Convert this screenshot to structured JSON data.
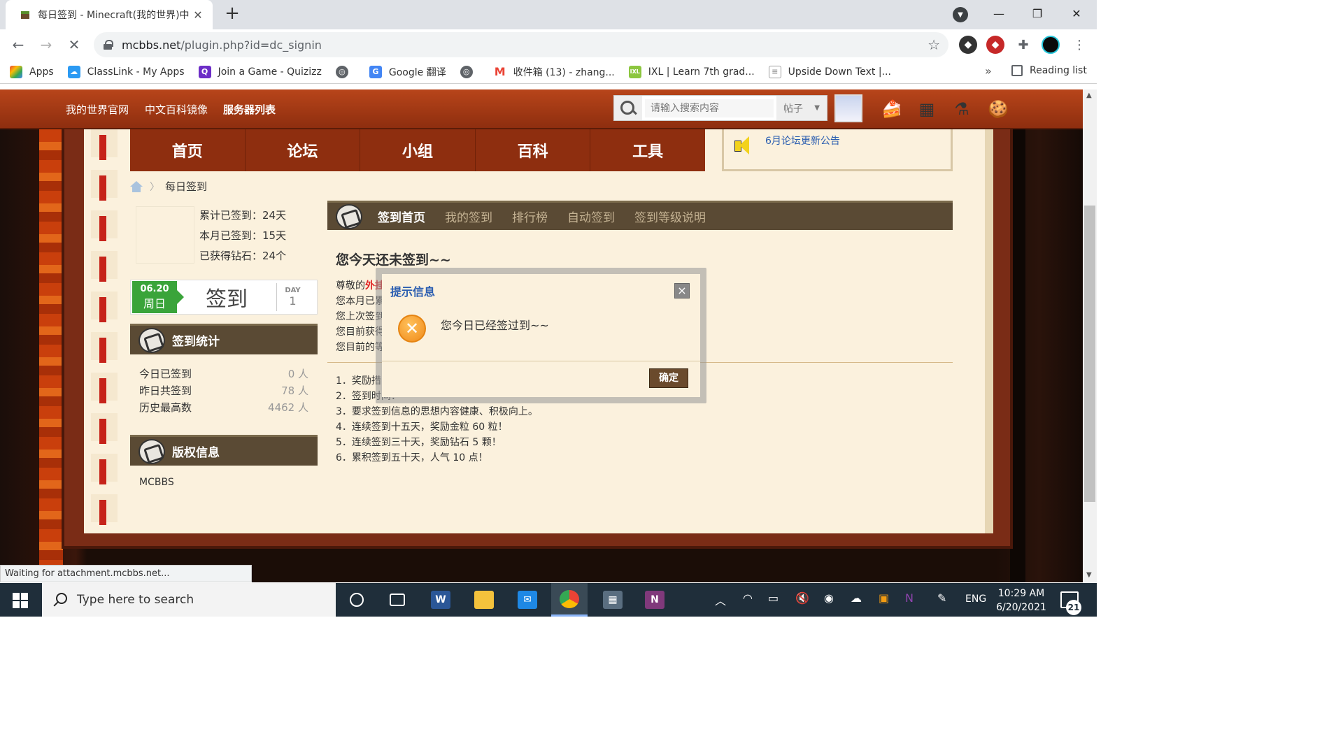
{
  "browser": {
    "tab_title": "每日签到 - Minecraft(我的世界)中",
    "url_host": "mcbbs.net",
    "url_path": "/plugin.php?id=dc_signin",
    "bookmarks": [
      {
        "label": "Apps",
        "icon": "apps-grid-icon",
        "color": "#e8453c"
      },
      {
        "label": "ClassLink - My Apps",
        "icon": "classlink-icon",
        "color": "#2b9af3"
      },
      {
        "label": "Join a Game - Quizizz",
        "icon": "quizizz-icon",
        "color": "#6c2dc7"
      },
      {
        "label": "",
        "icon": "globe-icon",
        "color": "#5f6368"
      },
      {
        "label": "Google 翻译",
        "icon": "google-translate-icon",
        "color": "#4285f4"
      },
      {
        "label": "",
        "icon": "globe-icon",
        "color": "#5f6368"
      },
      {
        "label": "收件箱 (13) - zhang...",
        "icon": "gmail-icon",
        "color": "#ea4335"
      },
      {
        "label": "IXL | Learn 7th grad...",
        "icon": "ixl-icon",
        "color": "#8cc63f"
      },
      {
        "label": "Upside Down Text |...",
        "icon": "document-icon",
        "color": "#9e9e9e"
      }
    ],
    "bookmarks_more": "»",
    "reading_list": "Reading list",
    "status": "Waiting for attachment.mcbbs.net..."
  },
  "site": {
    "top_links": [
      "我的世界官网",
      "中文百科镜像",
      "服务器列表"
    ],
    "search_placeholder": "请输入搜索内容",
    "search_type": "帖子",
    "main_nav": [
      "首页",
      "论坛",
      "小组",
      "百科",
      "工具"
    ],
    "notice": "6月论坛更新公告",
    "breadcrumb": "每日签到"
  },
  "left": {
    "stats": [
      "累计已签到：24天",
      "本月已签到：15天",
      "已获得钻石：24个"
    ],
    "date": "06.20",
    "weekday": "周日",
    "signin_label": "签到",
    "day_label": "DAY",
    "day_value": "1",
    "section_stats": "签到统计",
    "stat_rows": [
      {
        "label": "今日已签到",
        "value": "0 人"
      },
      {
        "label": "昨日共签到",
        "value": "78 人"
      },
      {
        "label": "历史最高数",
        "value": "4462 人"
      }
    ],
    "section_copyright": "版权信息",
    "copyright": "MCBBS"
  },
  "right": {
    "subnav": [
      "签到首页",
      "我的签到",
      "排行榜",
      "自动签到",
      "签到等级说明"
    ],
    "title": "您今天还未签到~~",
    "lines": [
      "尊敬的",
      "您本月已累",
      "您上次签到",
      "您目前获得",
      "您目前的等"
    ],
    "red_word": "外挂",
    "rules": [
      "1．奖励措",
      "2．签到时间：",
      "3．要求签到信息的思想内容健康、积极向上。",
      "4．连续签到十五天，奖励金粒 60 粒！",
      "5．连续签到三十天，奖励钻石 5 颗！",
      "6．累积签到五十天，人气 10 点！"
    ]
  },
  "dialog": {
    "title": "提示信息",
    "close": "×",
    "message": "您今日已经签过到~~",
    "ok": "确定"
  },
  "taskbar": {
    "search_placeholder": "Type here to search",
    "lang": "ENG",
    "time": "10:29 AM",
    "date": "6/20/2021",
    "notifications": "21"
  }
}
